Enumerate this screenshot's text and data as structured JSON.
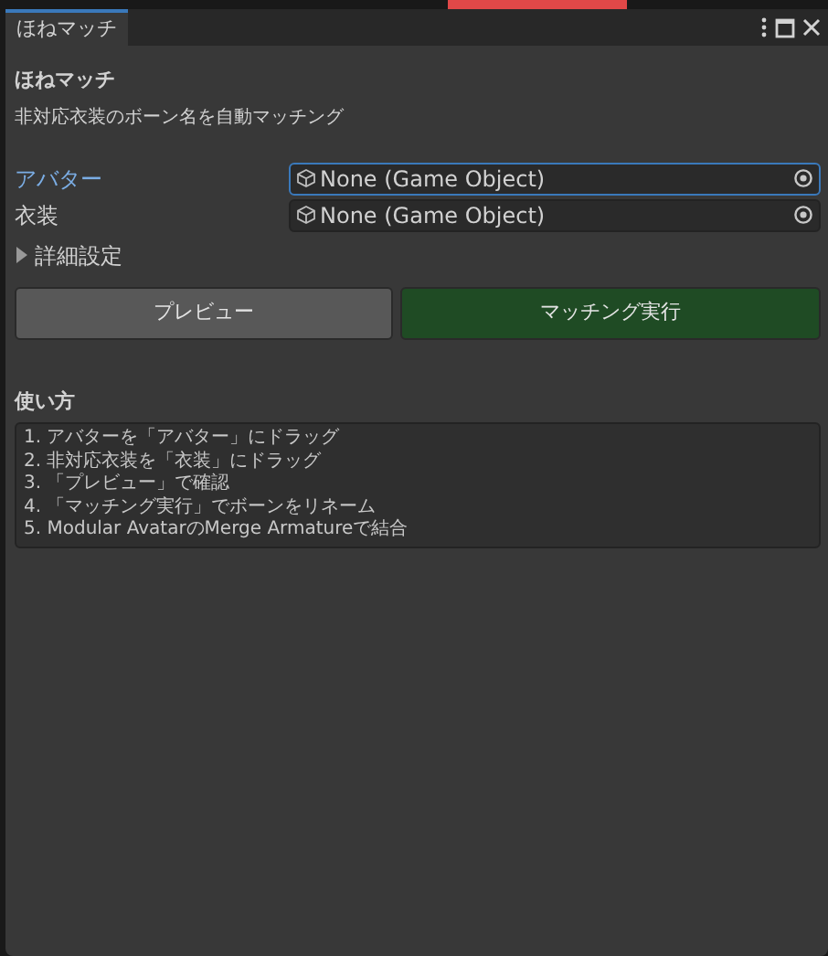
{
  "tab": {
    "title": "ほねマッチ",
    "selected": true
  },
  "header": {
    "title": "ほねマッチ",
    "subtitle": "非対応衣装のボーン名を自動マッチング"
  },
  "fields": [
    {
      "label": "アバター",
      "value": "None (Game Object)",
      "focused": true
    },
    {
      "label": "衣装",
      "value": "None (Game Object)",
      "focused": false
    }
  ],
  "foldout": {
    "label": "詳細設定",
    "expanded": false
  },
  "buttons": [
    {
      "label": "プレビュー",
      "kind": "normal"
    },
    {
      "label": "マッチング実行",
      "kind": "primary"
    }
  ],
  "usage": {
    "heading": "使い方",
    "lines": [
      "1. アバターを「アバター」にドラッグ",
      "2. 非対応衣装を「衣装」にドラッグ",
      "3. 「プレビュー」で確認",
      "4. 「マッチング実行」でボーンをリネーム",
      "5. Modular AvatarのMerge Armatureで結合"
    ]
  }
}
